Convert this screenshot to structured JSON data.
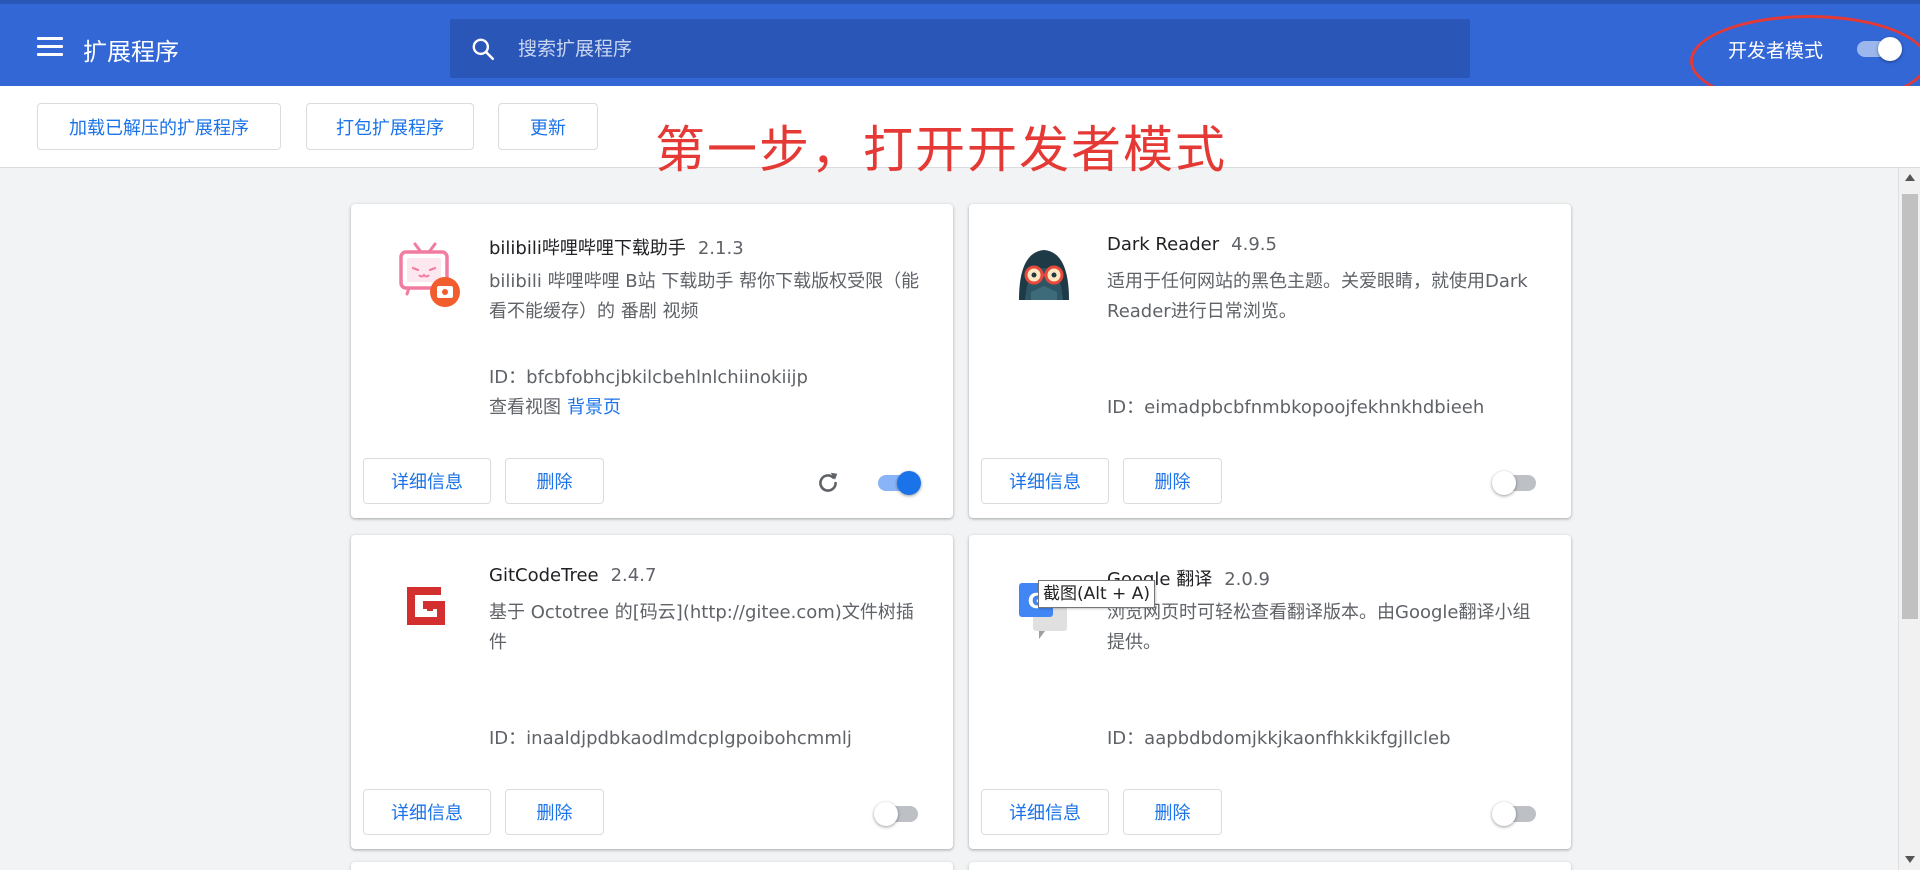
{
  "header": {
    "title": "扩展程序",
    "search_placeholder": "搜索扩展程序",
    "dev_mode_label": "开发者模式",
    "dev_mode_on": true
  },
  "toolbar": {
    "load_unpacked": "加载已解压的扩展程序",
    "pack_extension": "打包扩展程序",
    "update": "更新"
  },
  "annotation": {
    "text": "第一步，打开开发者模式",
    "color": "#e53935"
  },
  "tooltip": "截图(Alt + A)",
  "colors": {
    "header_bg": "#3367d6",
    "accent": "#1a73e8",
    "annotation_red": "#e53935"
  },
  "extensions": [
    {
      "name": "bilibili哔哩哔哩下载助手",
      "version": "2.1.3",
      "description": "bilibili 哔哩哔哩 B站 下载助手 帮你下载版权受限（能看不能缓存）的 番剧 视频",
      "id": "ID：bfcbfobhcjbkilcbehlnlchiinokiijp",
      "views_label": "查看视图",
      "views_link": "背景页",
      "icon": "bilibili-tv-icon",
      "enabled": true,
      "details_label": "详细信息",
      "remove_label": "删除"
    },
    {
      "name": "Dark Reader",
      "version": "4.9.5",
      "description": "适用于任何网站的黑色主题。关爱眼睛，就使用Dark Reader进行日常浏览。",
      "id": "ID：eimadpbcbfnmbkopoojfekhnkhdbieeh",
      "icon": "dark-reader-icon",
      "enabled": false,
      "details_label": "详细信息",
      "remove_label": "删除"
    },
    {
      "name": "GitCodeTree",
      "version": "2.4.7",
      "description": "基于 Octotree 的[码云](http://gitee.com)文件树插件",
      "id": "ID：inaaldjpdbkaodlmdcplgpoibohcmmlj",
      "icon": "gitcodetree-icon",
      "enabled": false,
      "details_label": "详细信息",
      "remove_label": "删除"
    },
    {
      "name": "Google 翻译",
      "version": "2.0.9",
      "description": "浏览网页时可轻松查看翻译版本。由Google翻译小组提供。",
      "id": "ID：aapbdbdomjkkjkaonfhkkikfgjllcleb",
      "icon": "google-translate-icon",
      "enabled": false,
      "details_label": "详细信息",
      "remove_label": "删除"
    }
  ]
}
